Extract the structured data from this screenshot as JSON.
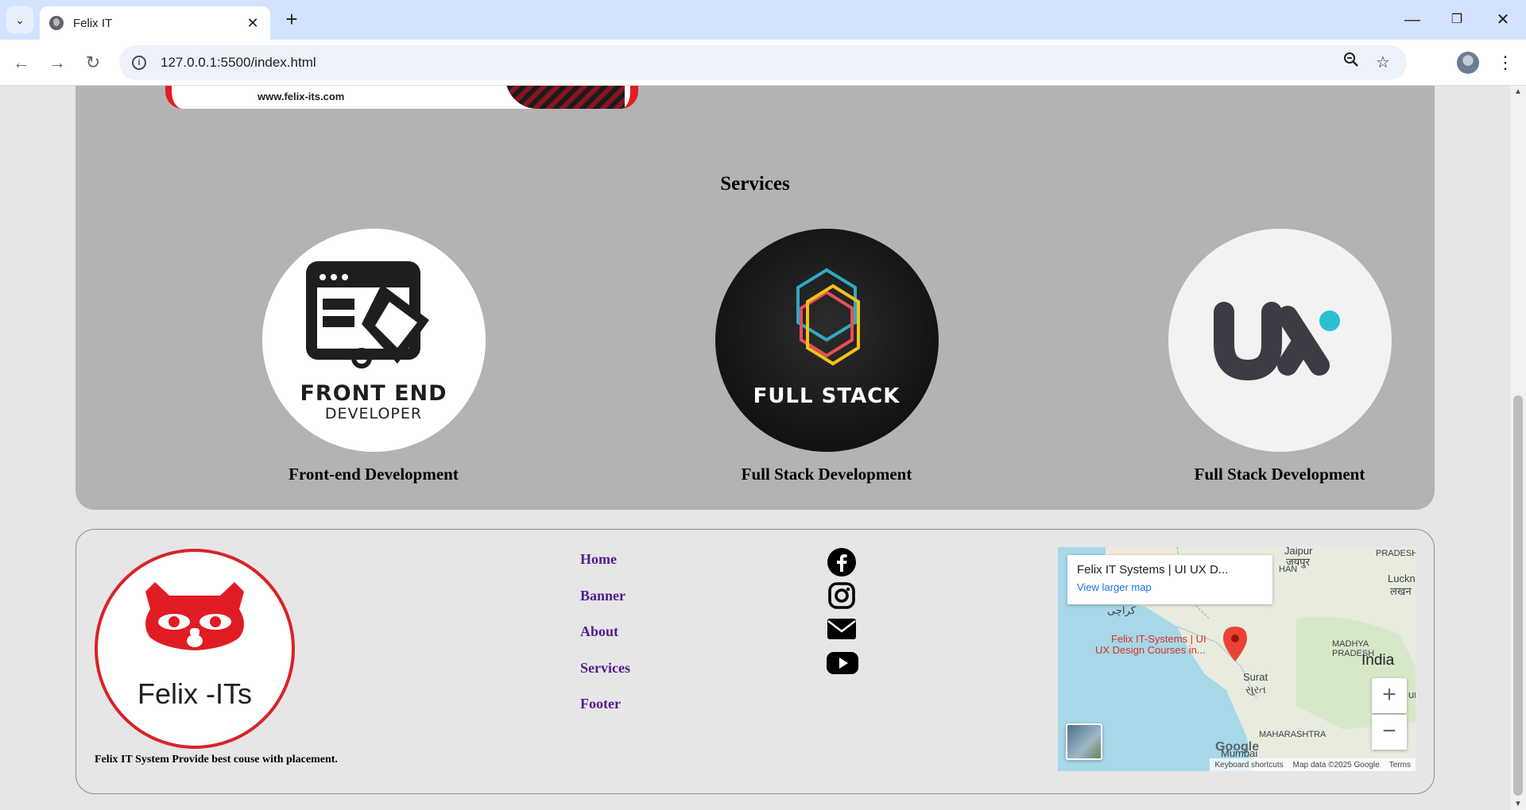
{
  "browser": {
    "tab_title": "Felix IT",
    "url": "127.0.0.1:5500/index.html",
    "tab_close": "✕",
    "new_tab": "+",
    "minimize": "—",
    "restore": "❐",
    "close": "✕",
    "back": "←",
    "forward": "→",
    "reload": "↻",
    "zoom": "🔍",
    "bookmark": "☆",
    "menu": "⋮",
    "tab_list": "⌄"
  },
  "banner": {
    "url_text": "www.felix-its.com"
  },
  "services": {
    "title": "Services",
    "items": [
      {
        "label": "Front-end Development",
        "logo_line1": "FRONT END",
        "logo_line2": "DEVELOPER"
      },
      {
        "label": "Full Stack Development",
        "logo_line1": "FULL STACK"
      },
      {
        "label": "Full Stack Development",
        "logo_line1": "ux"
      }
    ]
  },
  "footer": {
    "logo_text": "Felix -ITs",
    "tagline": "Felix IT System Provide best couse with placement.",
    "links": [
      "Home",
      "Banner",
      "About",
      "Services",
      "Footer"
    ],
    "social": [
      "facebook-icon",
      "instagram-icon",
      "mail-icon",
      "youtube-icon"
    ]
  },
  "map": {
    "title": "Felix IT Systems | UI UX D...",
    "view_larger": "View larger map",
    "place_line1": "Felix IT-Systems | UI",
    "place_line2": "UX Design Courses in...",
    "cities": {
      "jaipur": "Jaipur",
      "jaipur_hi": "जयपुर",
      "pradesh": "PRADESH",
      "han": "HAN",
      "luckn": "Luckn",
      "luckn_hi": "लखन",
      "karachi": "کراچی",
      "madhya": "MADHYA",
      "pradesh2": "PRADESH",
      "india": "India",
      "surat": "Surat",
      "surat_gu": "સુરત",
      "maharashtra": "MAHARASHTRA",
      "mumbai": "Mumbai",
      "ur": "ur"
    },
    "zoom_in": "+",
    "zoom_out": "−",
    "google": "Google",
    "keyboard": "Keyboard shortcuts",
    "map_data": "Map data ©2025 Google",
    "terms": "Terms"
  },
  "colors": {
    "card_bg": "#b3b3b3",
    "page_bg": "#e6e6e6",
    "link": "#551a8b",
    "brand_red": "#e01c24"
  }
}
